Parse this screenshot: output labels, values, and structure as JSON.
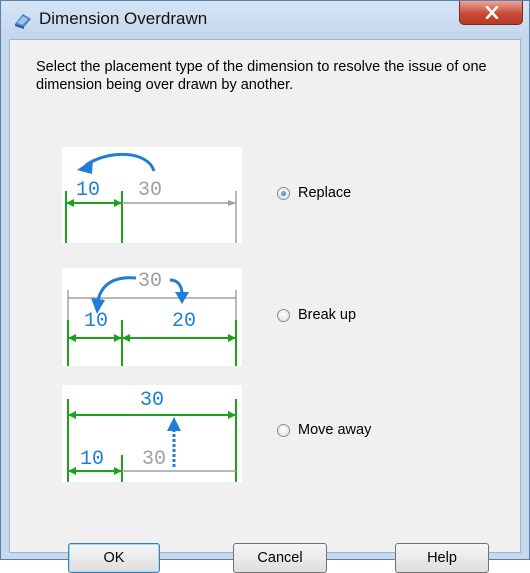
{
  "window": {
    "title": "Dimension Overdrawn",
    "icon": "dimension-app-icon"
  },
  "description": "Select the placement type of the dimension to resolve the issue of one dimension being over drawn by another.",
  "options": [
    {
      "label": "Replace",
      "checked": true
    },
    {
      "label": "Break up",
      "checked": false
    },
    {
      "label": "Move away",
      "checked": false
    }
  ],
  "illustrations": {
    "replace": {
      "small": "10",
      "large": "30"
    },
    "break_up": {
      "large": "30",
      "left": "10",
      "right": "20"
    },
    "move_away": {
      "top": "30",
      "small": "10",
      "large": "30"
    }
  },
  "buttons": {
    "ok": "OK",
    "cancel": "Cancel",
    "help": "Help"
  },
  "colors": {
    "dimension_blue": "#1f7fd6",
    "extension_green": "#1aa31a",
    "muted_gray": "#a0a0a0"
  }
}
